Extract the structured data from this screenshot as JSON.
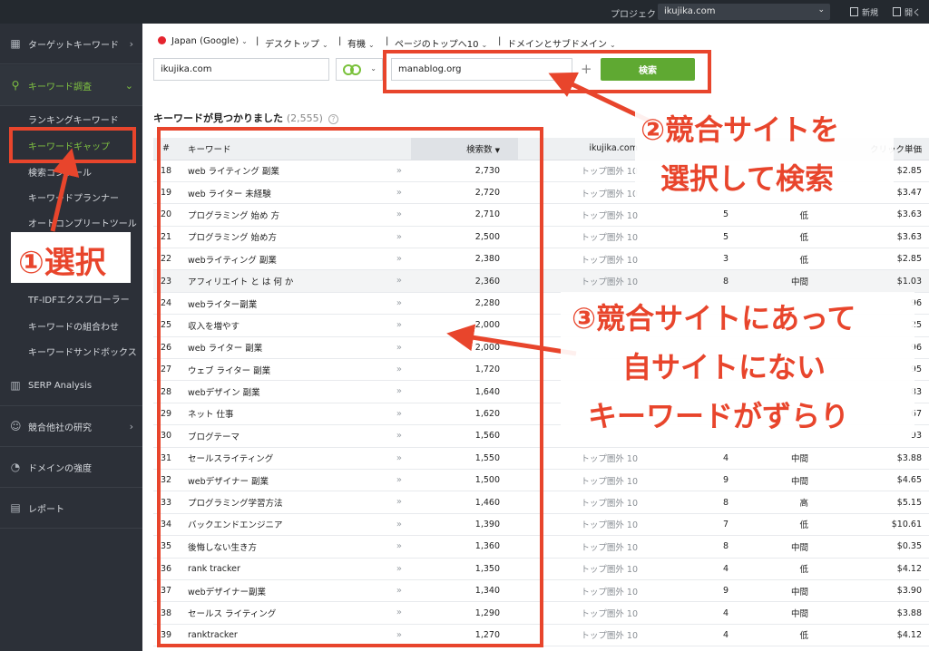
{
  "topbar": {
    "project_label": "プロジェクト：",
    "project_value": "ikujika.com",
    "new_label": "新規",
    "open_label": "開く"
  },
  "sidebar": {
    "main_items": [
      {
        "label": "ターゲットキーワード",
        "icon": "dashboard-icon"
      },
      {
        "label": "キーワード調査",
        "icon": "search-icon",
        "active": true
      },
      {
        "label": "SERP Analysis",
        "icon": "bar-chart-icon"
      },
      {
        "label": "競合他社の研究",
        "icon": "user-icon"
      },
      {
        "label": "ドメインの強度",
        "icon": "gauge-icon"
      },
      {
        "label": "レポート",
        "icon": "report-icon"
      }
    ],
    "sub_items": [
      {
        "label": "ランキングキーワード"
      },
      {
        "label": "キーワードギャップ",
        "active": true
      },
      {
        "label": "検索コンソール"
      },
      {
        "label": "キーワードプランナー"
      },
      {
        "label": "オートコンプリートツール"
      },
      {
        "label": "TF-IDFエクスプローラー"
      },
      {
        "label": "キーワードの組合わせ"
      },
      {
        "label": "キーワードサンドボックス"
      }
    ]
  },
  "filters": {
    "country": "Japan (Google)",
    "device": "デスクトップ",
    "result_type": "有機",
    "position": "ページのトップへ10",
    "scope": "ドメインとサブドメイン"
  },
  "search": {
    "own_site": "ikujika.com",
    "competitor": "manablog.org",
    "button_label": "検索"
  },
  "results": {
    "heading": "キーワードが見つかりました",
    "count": "(2,555)"
  },
  "table": {
    "headers": {
      "num": "#",
      "keyword": "キーワード",
      "volume": "検索数",
      "site": "ikujika.com",
      "cpc": "クリック単価"
    },
    "rows": [
      {
        "num": "18",
        "kw": "web ライティング 副業",
        "vol": "2,730",
        "site": "トップ圏外 10",
        "comp": "",
        "lvl": "",
        "cpc": "$2.85"
      },
      {
        "num": "19",
        "kw": "web ライター 未経験",
        "vol": "2,720",
        "site": "トップ圏外 10",
        "comp": "",
        "lvl": "",
        "cpc": "$3.47"
      },
      {
        "num": "20",
        "kw": "プログラミング 始め 方",
        "vol": "2,710",
        "site": "トップ圏外 10",
        "comp": "5",
        "lvl": "低",
        "cpc": "$3.63"
      },
      {
        "num": "21",
        "kw": "プログラミング 始め方",
        "vol": "2,500",
        "site": "トップ圏外 10",
        "comp": "5",
        "lvl": "低",
        "cpc": "$3.63"
      },
      {
        "num": "22",
        "kw": "webライティング 副業",
        "vol": "2,380",
        "site": "トップ圏外 10",
        "comp": "3",
        "lvl": "低",
        "cpc": "$2.85"
      },
      {
        "num": "23",
        "kw": "アフィリエイト と は 何 か",
        "vol": "2,360",
        "site": "トップ圏外 10",
        "comp": "8",
        "lvl": "中間",
        "cpc": "$1.03"
      },
      {
        "num": "24",
        "kw": "webライター副業",
        "vol": "2,280",
        "site": "",
        "comp": "",
        "lvl": "",
        "cpc": "96"
      },
      {
        "num": "25",
        "kw": "収入を増やす",
        "vol": "2,000",
        "site": "",
        "comp": "",
        "lvl": "",
        "cpc": "25"
      },
      {
        "num": "26",
        "kw": "web ライター 副業",
        "vol": "2,000",
        "site": "",
        "comp": "",
        "lvl": "",
        "cpc": "96"
      },
      {
        "num": "27",
        "kw": "ウェブ ライター 副業",
        "vol": "1,720",
        "site": "",
        "comp": "",
        "lvl": "",
        "cpc": "95"
      },
      {
        "num": "28",
        "kw": "webデザイン 副業",
        "vol": "1,640",
        "site": "",
        "comp": "",
        "lvl": "",
        "cpc": "83"
      },
      {
        "num": "29",
        "kw": "ネット 仕事",
        "vol": "1,620",
        "site": "",
        "comp": "",
        "lvl": "",
        "cpc": "67"
      },
      {
        "num": "30",
        "kw": "ブログテーマ",
        "vol": "1,560",
        "site": "",
        "comp": "",
        "lvl": "",
        "cpc": "93"
      },
      {
        "num": "31",
        "kw": "セールスライティング",
        "vol": "1,550",
        "site": "トップ圏外 10",
        "comp": "4",
        "lvl": "中間",
        "cpc": "$3.88"
      },
      {
        "num": "32",
        "kw": "webデザイナー 副業",
        "vol": "1,500",
        "site": "トップ圏外 10",
        "comp": "9",
        "lvl": "中間",
        "cpc": "$4.65"
      },
      {
        "num": "33",
        "kw": "プログラミング学習方法",
        "vol": "1,460",
        "site": "トップ圏外 10",
        "comp": "8",
        "lvl": "高",
        "cpc": "$5.15"
      },
      {
        "num": "34",
        "kw": "バックエンドエンジニア",
        "vol": "1,390",
        "site": "トップ圏外 10",
        "comp": "7",
        "lvl": "低",
        "cpc": "$10.61"
      },
      {
        "num": "35",
        "kw": "後悔しない生き方",
        "vol": "1,360",
        "site": "トップ圏外 10",
        "comp": "8",
        "lvl": "中間",
        "cpc": "$0.35"
      },
      {
        "num": "36",
        "kw": "rank tracker",
        "vol": "1,350",
        "site": "トップ圏外 10",
        "comp": "4",
        "lvl": "低",
        "cpc": "$4.12"
      },
      {
        "num": "37",
        "kw": "webデザイナー副業",
        "vol": "1,340",
        "site": "トップ圏外 10",
        "comp": "9",
        "lvl": "中間",
        "cpc": "$3.90"
      },
      {
        "num": "38",
        "kw": "セールス ライティング",
        "vol": "1,290",
        "site": "トップ圏外 10",
        "comp": "4",
        "lvl": "中間",
        "cpc": "$3.88"
      },
      {
        "num": "39",
        "kw": "ranktracker",
        "vol": "1,270",
        "site": "トップ圏外 10",
        "comp": "4",
        "lvl": "低",
        "cpc": "$4.12"
      }
    ]
  },
  "annotations": {
    "step1": "①選択",
    "step2_line1": "②競合サイトを",
    "step2_line2": "選択して検索",
    "step3_line1": "③競合サイトにあって",
    "step3_line2": "自サイトにない",
    "step3_line3": "キーワードがずらり"
  },
  "colors": {
    "accent_green": "#7fc241",
    "button_green": "#5fa932",
    "annotation_red": "#e8452c",
    "sidebar_bg": "#2c3038"
  }
}
